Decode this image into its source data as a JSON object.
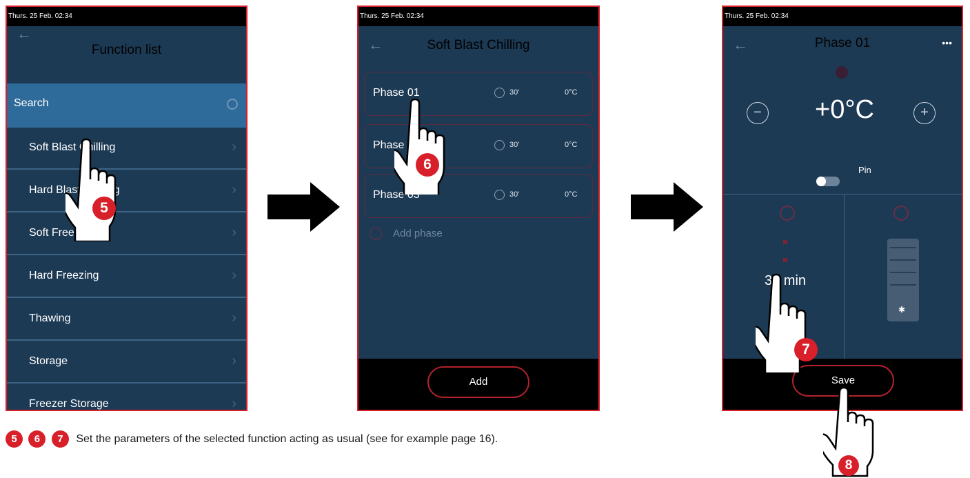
{
  "status_time": "Thurs. 25 Feb. 02:34",
  "screen1": {
    "title": "Function list",
    "search_label": "Search",
    "items": [
      "Soft Blast Chilling",
      "Hard Blast Chilling",
      "Soft Freezing",
      "Hard Freezing",
      "Thawing",
      "Storage",
      "Freezer Storage"
    ]
  },
  "screen2": {
    "title": "Soft Blast Chilling",
    "phases": [
      {
        "label": "Phase 01",
        "time": "30'",
        "temp": "0°C"
      },
      {
        "label": "Phase 02",
        "time": "30'",
        "temp": "0°C"
      },
      {
        "label": "Phase 03",
        "time": "30'",
        "temp": "0°C"
      }
    ],
    "add_phase": "Add phase",
    "add_button": "Add"
  },
  "screen3": {
    "title": "Phase 01",
    "more": "•••",
    "temperature": "+0°C",
    "minus": "−",
    "plus": "+",
    "pin_label": "Pin",
    "time_value": "30 min",
    "save_button": "Save"
  },
  "steps": {
    "s5": "5",
    "s6": "6",
    "s7": "7",
    "s8": "8"
  },
  "caption": "Set the parameters of the selected function acting as usual (see for example page 16).",
  "colors": {
    "panel": "#1d3a55",
    "accent": "#d8202a",
    "search": "#2f6b9a"
  }
}
